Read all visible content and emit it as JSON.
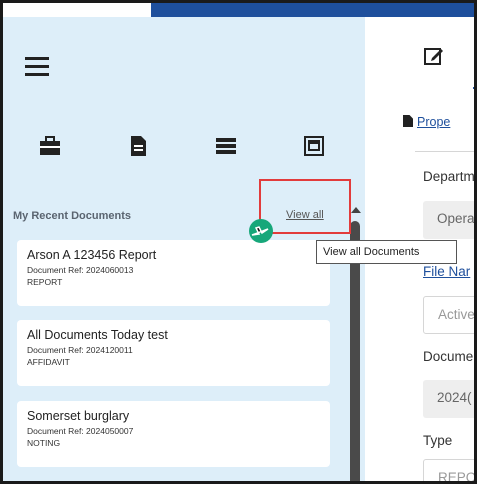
{
  "sidebar": {
    "recent_title": "My Recent Documents",
    "view_all": "View all",
    "icons": [
      "briefcase-icon",
      "document-icon",
      "server-icon",
      "window-frame-icon"
    ],
    "documents": [
      {
        "title": "Arson A 123456 Report",
        "ref": "Document Ref: 2024060013",
        "type": "REPORT"
      },
      {
        "title": "All Documents Today test",
        "ref": "Document Ref: 2024120011",
        "type": "AFFIDAVIT"
      },
      {
        "title": "Somerset burglary",
        "ref": "Document Ref: 2024050007",
        "type": "NOTING"
      }
    ]
  },
  "tooltip": {
    "text": "View all Documents"
  },
  "right": {
    "properties_link": "Prope",
    "department_label": "Departm",
    "department_value": "Opera",
    "file_name_label": "File Nar",
    "file_name_value": "Active",
    "document_label": "Docume",
    "document_value": "2024(",
    "type_label": "Type",
    "type_value": "REPO"
  },
  "colors": {
    "sidebar_bg": "#ddeef9",
    "brand_blue": "#1e4f9c",
    "highlight_red": "#e23b3b",
    "cursor_green": "#17a77a"
  }
}
